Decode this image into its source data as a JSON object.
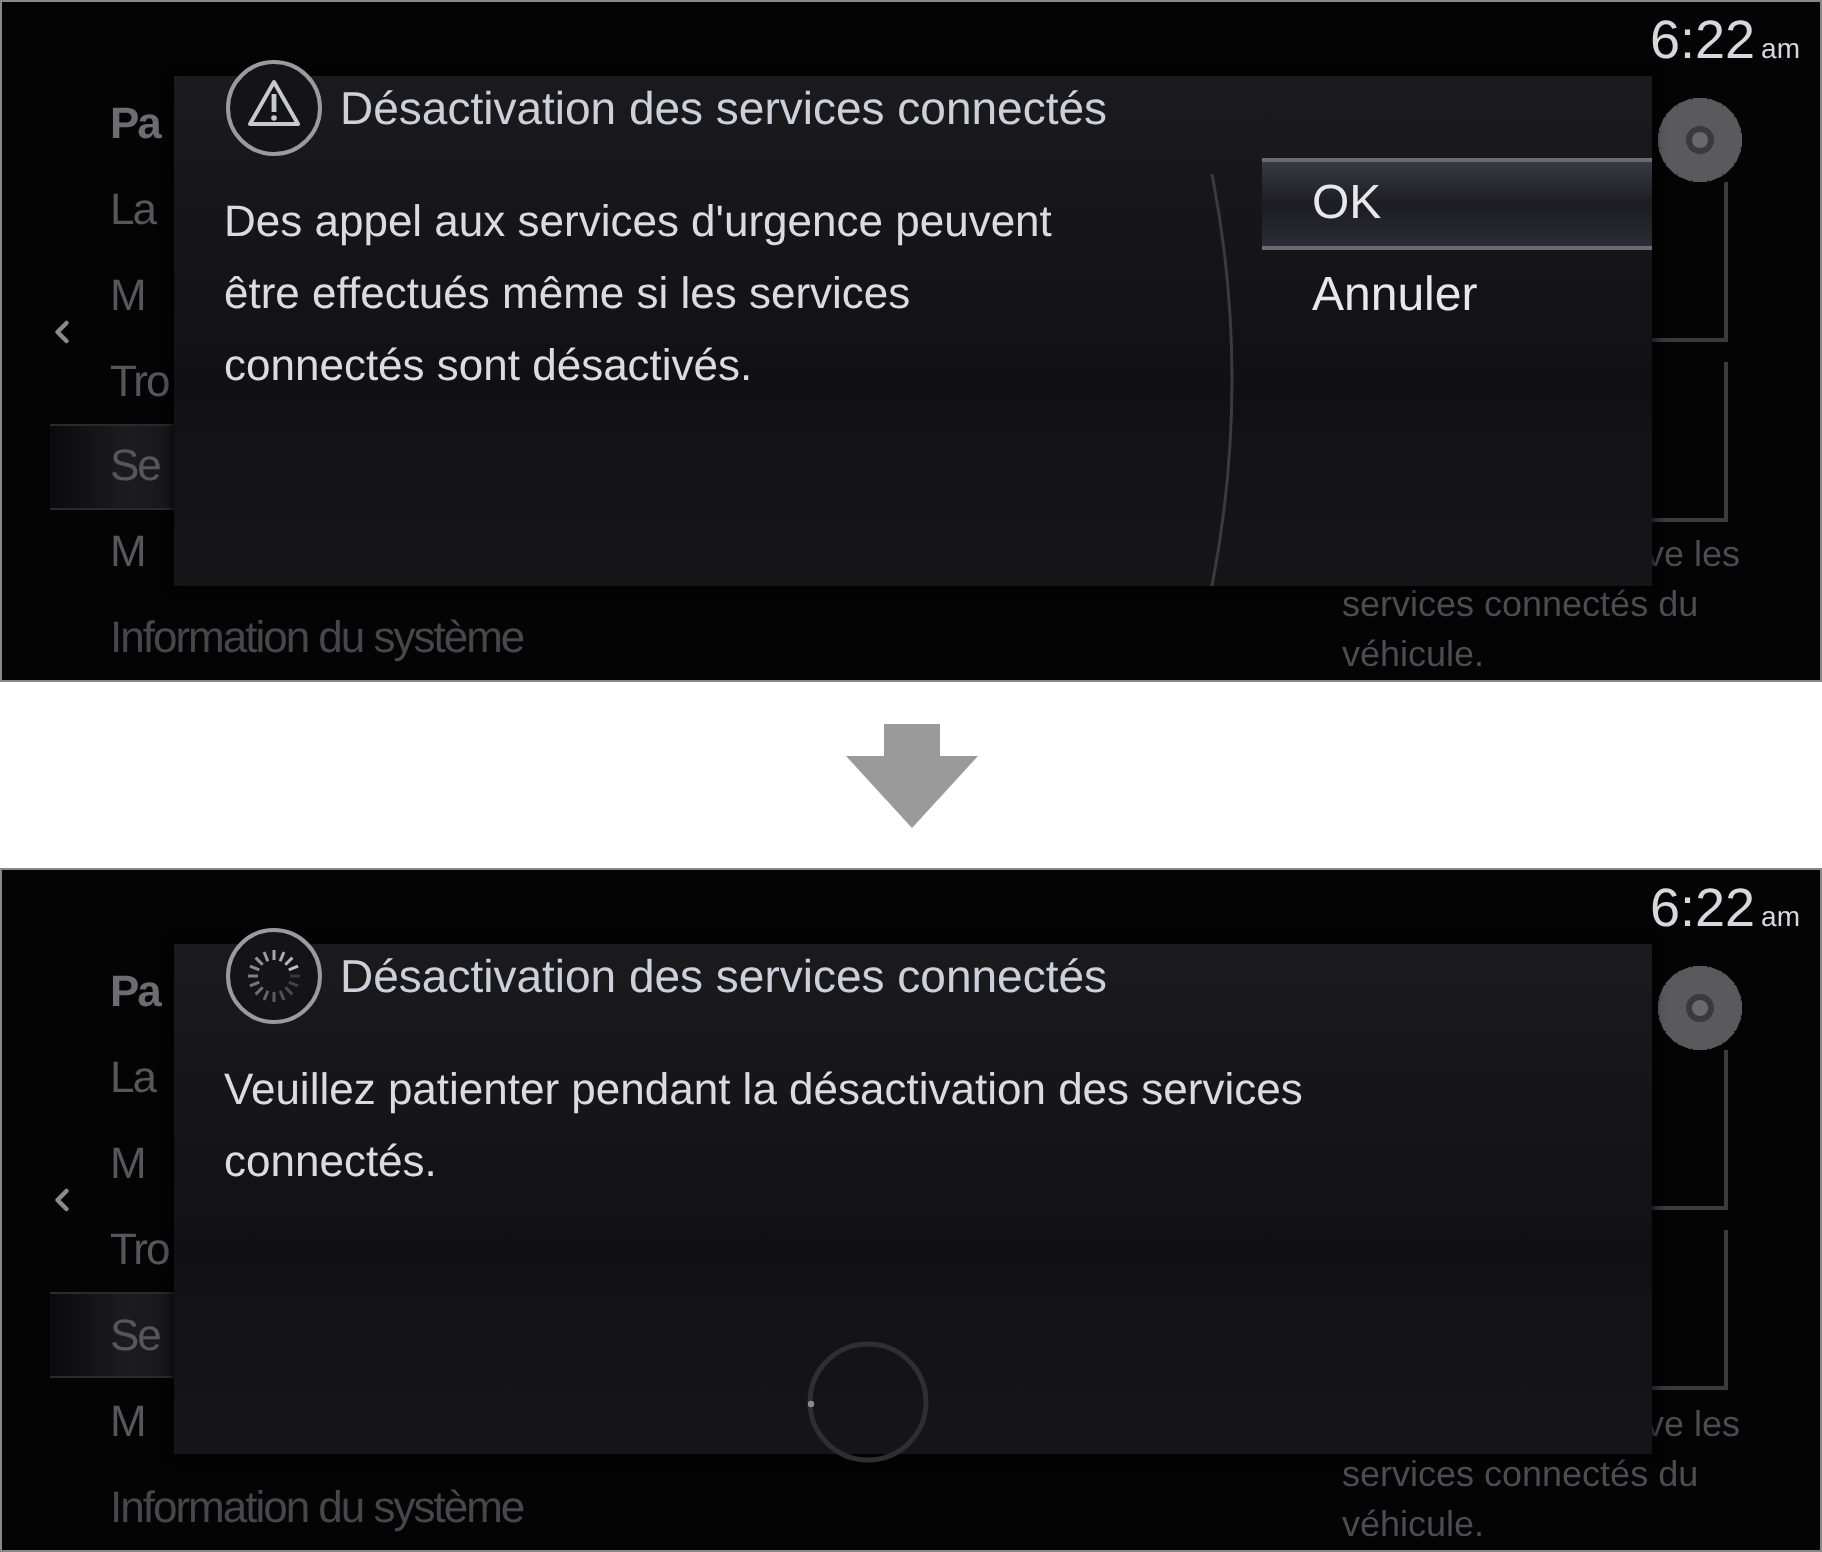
{
  "screens": [
    {
      "clock": {
        "time": "6:22",
        "suffix": "am"
      },
      "menu": [
        {
          "label": "Pa",
          "kind": "header",
          "selected": false
        },
        {
          "label": "La",
          "kind": "item",
          "selected": false
        },
        {
          "label": "M",
          "kind": "item",
          "selected": false
        },
        {
          "label": "Tro",
          "kind": "item",
          "selected": false
        },
        {
          "label": "Se",
          "kind": "item",
          "selected": true
        },
        {
          "label": "M",
          "kind": "item",
          "selected": false
        },
        {
          "label": "Information du système",
          "kind": "item",
          "selected": false
        }
      ],
      "side_text": [
        "ve les",
        "services connectés du",
        "véhicule."
      ],
      "dialog": {
        "kind": "confirm",
        "title": "Désactivation des services connectés",
        "message": "Des appel aux services d'urgence peuvent être effectués même si les services connectés sont désactivés.",
        "options": [
          {
            "label": "OK",
            "selected": true
          },
          {
            "label": "Annuler",
            "selected": false
          }
        ]
      }
    },
    {
      "clock": {
        "time": "6:22",
        "suffix": "am"
      },
      "menu": [
        {
          "label": "Pa",
          "kind": "header",
          "selected": false
        },
        {
          "label": "La",
          "kind": "item",
          "selected": false
        },
        {
          "label": "M",
          "kind": "item",
          "selected": false
        },
        {
          "label": "Tro",
          "kind": "item",
          "selected": false
        },
        {
          "label": "Se",
          "kind": "item",
          "selected": true
        },
        {
          "label": "M",
          "kind": "item",
          "selected": false
        },
        {
          "label": "Information du système",
          "kind": "item",
          "selected": false
        }
      ],
      "side_text": [
        "ve les",
        "services connectés du",
        "véhicule."
      ],
      "dialog": {
        "kind": "progress",
        "title": "Désactivation des services connectés",
        "message": "Veuillez patienter pendant la désactivation des services connectés."
      }
    }
  ]
}
